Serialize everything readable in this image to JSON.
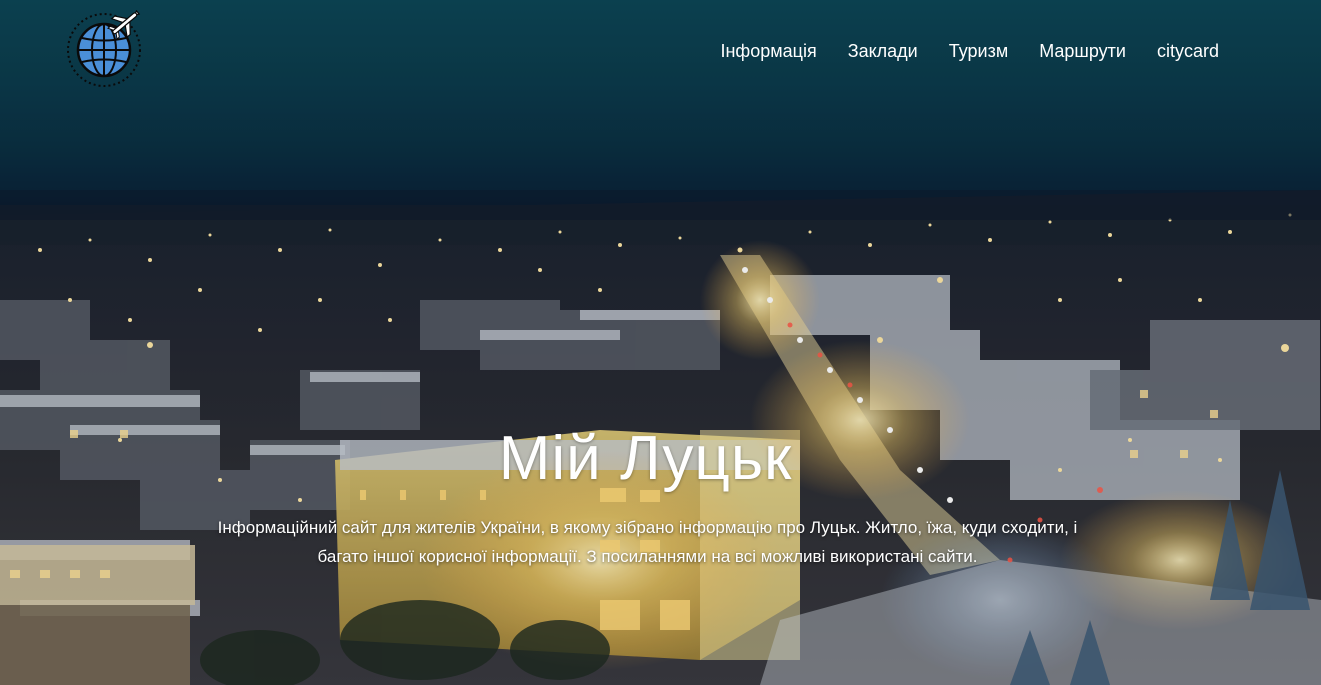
{
  "nav": {
    "logo_icon": "globe-airplane-icon",
    "items": [
      {
        "label": "Інформація"
      },
      {
        "label": "Заклади"
      },
      {
        "label": "Туризм"
      },
      {
        "label": "Маршрути"
      },
      {
        "label": "citycard"
      }
    ]
  },
  "hero": {
    "title": "Мій Луцьк",
    "subtitle": "Інформаційний сайт для жителів України, в якому зібрано інформацію про Луцьк. Житло, їжа, куди сходити, і багато іншої корисної інформації. З посиланнями на всі можливі використані сайти.",
    "background_image": "night-city-aerial-view"
  },
  "colors": {
    "sky_top": "#0d4656",
    "sky_horizon": "#0a2338",
    "text": "#ffffff",
    "logo_globe": "#4a8fd8"
  }
}
